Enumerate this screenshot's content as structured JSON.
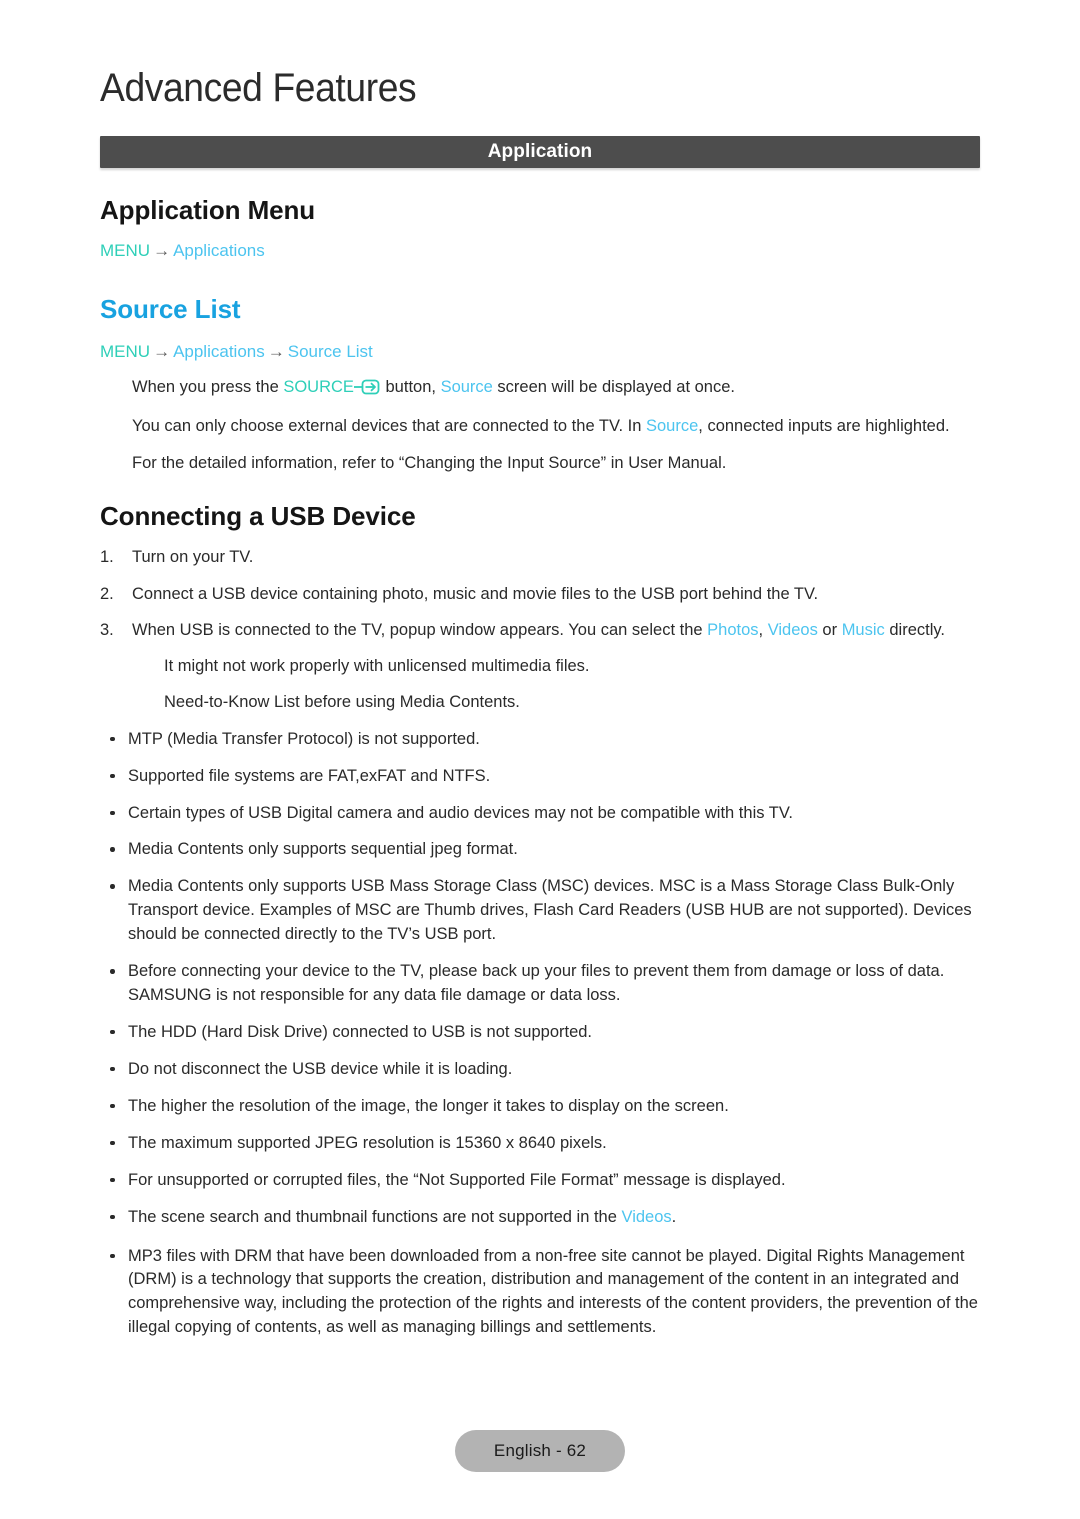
{
  "document": {
    "chapter_title": "Advanced Features",
    "section_bar_label": "Application"
  },
  "sections": {
    "application_menu": {
      "heading": "Application Menu",
      "breadcrumb": {
        "menu": "MENU",
        "arrow": "→",
        "item1": "Applications"
      }
    },
    "source_list": {
      "heading": "Source List",
      "breadcrumb": {
        "menu": "MENU",
        "arrow1": "→",
        "item1": "Applications",
        "arrow2": "→",
        "item2": "Source List"
      },
      "paragraphs": {
        "p1_a": "When you press the ",
        "p1_source_label": "SOURCE",
        "p1_b": " button, ",
        "p1_source_word": "Source",
        "p1_c": " screen will be displayed at once.",
        "p2_a": "You can only choose external devices that are connected to the TV. In ",
        "p2_source_word": "Source",
        "p2_b": ", connected inputs are highlighted.",
        "p3": "For the detailed information, refer to “Changing the Input Source” in User Manual."
      }
    },
    "connecting_usb": {
      "heading": "Connecting a USB Device",
      "steps": [
        {
          "num": "1.",
          "text": "Turn on your TV."
        },
        {
          "num": "2.",
          "text": "Connect a USB device containing photo, music and movie files to the USB port behind the TV."
        }
      ],
      "step3": {
        "num": "3.",
        "a": "When USB is connected to the TV, popup window appears. You can select the ",
        "photos": "Photos",
        "sep1": ", ",
        "videos": "Videos",
        "sep2": " or ",
        "music": "Music",
        "b": " directly."
      },
      "substeps": [
        "It might not work properly with unlicensed multimedia files.",
        "Need-to-Know List before using Media Contents."
      ],
      "bullets": [
        "MTP (Media Transfer Protocol) is not supported.",
        "Supported file systems are FAT,exFAT and NTFS.",
        "Certain types of USB Digital camera and audio devices may not be compatible with this TV.",
        "Media Contents only supports sequential jpeg format.",
        "Media Contents only supports USB Mass Storage Class (MSC) devices. MSC is a Mass Storage Class Bulk-Only Transport device. Examples of MSC are Thumb drives, Flash Card Readers (USB HUB are not supported). Devices should be connected directly to the TV’s USB port.",
        "Before connecting your device to the TV, please back up your files to prevent them from damage or loss of data. SAMSUNG is not responsible for any data file damage or data loss.",
        "The HDD (Hard Disk Drive) connected to USB is not supported.",
        "Do not disconnect the USB device while it is loading.",
        "The higher the resolution of the image, the longer it takes to display on the screen.",
        "The maximum supported JPEG resolution is 15360 x 8640 pixels.",
        "For unsupported or corrupted files, the “Not Supported File Format” message is displayed."
      ],
      "bullet_videos": {
        "a": "The scene search and thumbnail functions are not supported in the ",
        "videos": "Videos",
        "b": "."
      },
      "bullet_drm": "MP3 files with DRM that have been downloaded from a non-free site cannot be played. Digital Rights Management (DRM) is a technology that supports the creation, distribution and management of the content in an integrated and comprehensive way, including the protection of the rights and interests of the content providers, the prevention of the illegal copying of contents, as well as managing billings and settlements."
    }
  },
  "footer": {
    "page_label": "English - 62"
  },
  "colors": {
    "section_bar": "#4d4d4d",
    "heading_blue": "#18a2e0",
    "accent_teal": "#2ecfb8",
    "accent_blue": "#4cc4ef",
    "footer_pill": "#b3b3b3"
  }
}
